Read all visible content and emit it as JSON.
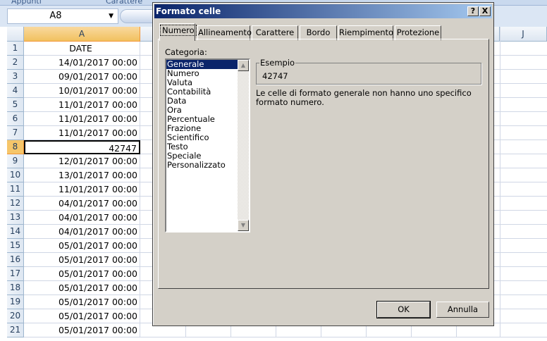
{
  "ribbon": {
    "groups": [
      "Appunti",
      "Carattere"
    ]
  },
  "name_box": {
    "value": "A8"
  },
  "columns": {
    "a": "A",
    "j": "J"
  },
  "rows": [
    {
      "n": "1",
      "v": "DATE"
    },
    {
      "n": "2",
      "v": "14/01/2017 00:00"
    },
    {
      "n": "3",
      "v": "09/01/2017 00:00"
    },
    {
      "n": "4",
      "v": "10/01/2017 00:00"
    },
    {
      "n": "5",
      "v": "11/01/2017 00:00"
    },
    {
      "n": "6",
      "v": "11/01/2017 00:00"
    },
    {
      "n": "7",
      "v": "11/01/2017 00:00"
    },
    {
      "n": "8",
      "v": "42747"
    },
    {
      "n": "9",
      "v": "12/01/2017 00:00"
    },
    {
      "n": "10",
      "v": "13/01/2017 00:00"
    },
    {
      "n": "11",
      "v": "11/01/2017 00:00"
    },
    {
      "n": "12",
      "v": "04/01/2017 00:00"
    },
    {
      "n": "13",
      "v": "04/01/2017 00:00"
    },
    {
      "n": "14",
      "v": "04/01/2017 00:00"
    },
    {
      "n": "15",
      "v": "05/01/2017 00:00"
    },
    {
      "n": "16",
      "v": "05/01/2017 00:00"
    },
    {
      "n": "17",
      "v": "05/01/2017 00:00"
    },
    {
      "n": "18",
      "v": "05/01/2017 00:00"
    },
    {
      "n": "19",
      "v": "05/01/2017 00:00"
    },
    {
      "n": "20",
      "v": "05/01/2017 00:00"
    },
    {
      "n": "21",
      "v": "05/01/2017 00:00"
    }
  ],
  "dialog": {
    "title": "Formato celle",
    "help": "?",
    "close": "X",
    "tabs": [
      "Numero",
      "Allineamento",
      "Carattere",
      "Bordo",
      "Riempimento",
      "Protezione"
    ],
    "category_label": "Categoria:",
    "categories": [
      "Generale",
      "Numero",
      "Valuta",
      "Contabilità",
      "Data",
      "Ora",
      "Percentuale",
      "Frazione",
      "Scientifico",
      "Testo",
      "Speciale",
      "Personalizzato"
    ],
    "selected_category": "Generale",
    "sample_label": "Esempio",
    "sample_value": "42747",
    "description": "Le celle di formato generale non hanno uno specifico formato numero.",
    "ok": "OK",
    "cancel": "Annulla"
  },
  "colors": {
    "title_start": "#0a246a",
    "title_end": "#a6caf0",
    "dialog_bg": "#d4d0c8",
    "selected_header": "#f6c66a"
  }
}
